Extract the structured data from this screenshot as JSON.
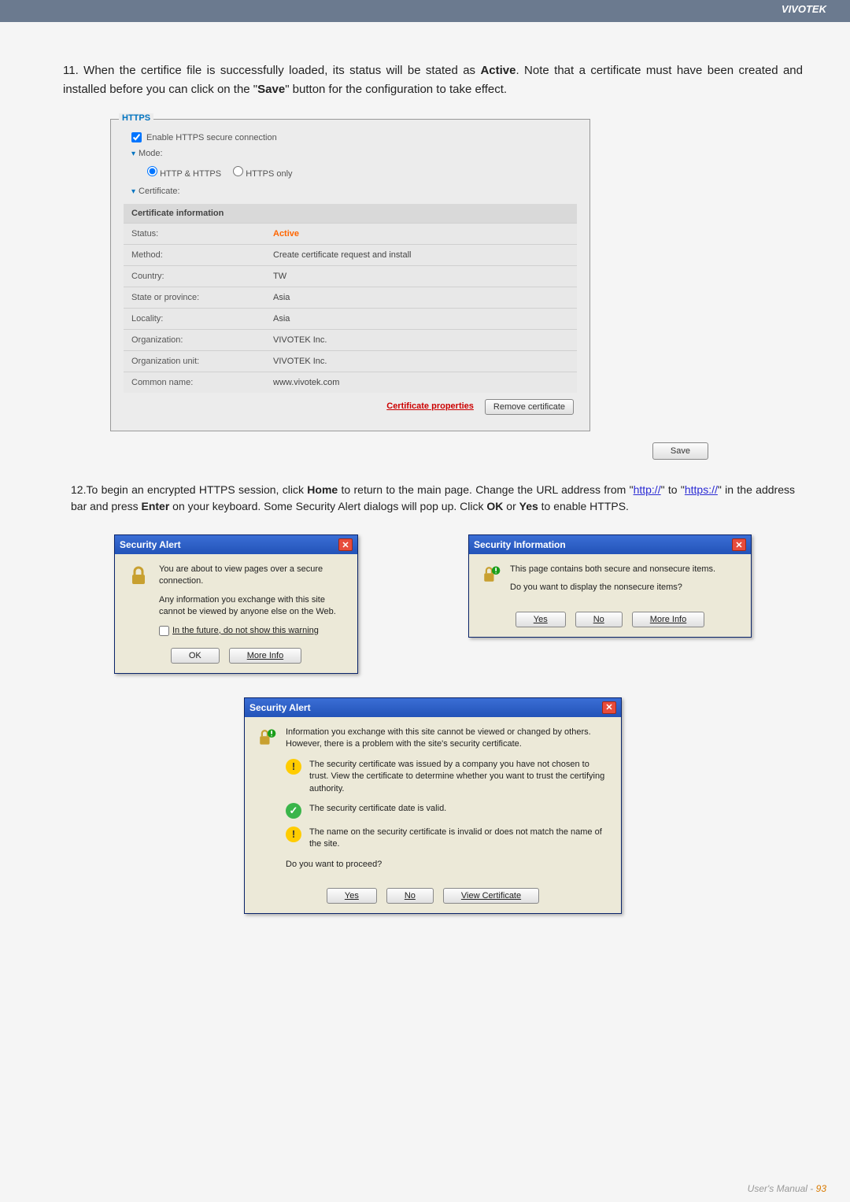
{
  "header": {
    "brand": "VIVOTEK"
  },
  "step11": {
    "num": "11.",
    "text_a": "When the certifice file is successfully loaded, its status will be stated as ",
    "active": "Active",
    "text_b": ". Note that a certificate must have been created and installed before you can click on the \"",
    "save": "Save",
    "text_c": "\" button for the configuration to take effect."
  },
  "panel": {
    "title": "HTTPS",
    "enable": "Enable HTTPS secure connection",
    "collapse": "▾",
    "mode": "Mode:",
    "opt1": "HTTP & HTTPS",
    "opt2": "HTTPS only",
    "cert_label": "Certificate:",
    "cert_info": "Certificate information",
    "rows": {
      "status_l": "Status:",
      "status_v": "Active",
      "method_l": "Method:",
      "method_v": "Create certificate request and install",
      "country_l": "Country:",
      "country_v": "TW",
      "state_l": "State or province:",
      "state_v": "Asia",
      "locality_l": "Locality:",
      "locality_v": "Asia",
      "org_l": "Organization:",
      "org_v": "VIVOTEK Inc.",
      "orgunit_l": "Organization unit:",
      "orgunit_v": "VIVOTEK Inc.",
      "cn_l": "Common name:",
      "cn_v": "www.vivotek.com"
    },
    "cert_props": "Certificate properties",
    "remove": "Remove certificate",
    "save_btn": "Save"
  },
  "step12": {
    "num": "12.",
    "text_a": "To begin an encrypted HTTPS session, click ",
    "home": "Home",
    "text_b": " to return to the main page. Change the URL address from \"",
    "http": "http://",
    "text_c": "\" to \"",
    "https": "https://",
    "text_d": "\" in the address bar and press ",
    "enter": "Enter",
    "text_e": " on your keyboard. Some Security Alert dialogs will pop up. Click ",
    "ok": "OK",
    "or": " or ",
    "yes": "Yes",
    "text_f": " to enable HTTPS."
  },
  "dlg1": {
    "title": "Security Alert",
    "line1": "You are about to view pages over a secure connection.",
    "line2": "Any information you exchange with this site cannot be viewed by anyone else on the Web.",
    "chk": "In the future, do not show this warning",
    "ok": "OK",
    "more": "More Info"
  },
  "dlg2": {
    "title": "Security Information",
    "line1": "This page contains both secure and nonsecure items.",
    "line2": "Do you want to display the nonsecure items?",
    "yes": "Yes",
    "no": "No",
    "more": "More Info"
  },
  "dlg3": {
    "title": "Security Alert",
    "intro": "Information you exchange with this site cannot be viewed or changed by others. However, there is a problem with the site's security certificate.",
    "w1": "The security certificate was issued by a company you have not chosen to trust. View the certificate to determine whether you want to trust the certifying authority.",
    "w2": "The security certificate date is valid.",
    "w3": "The name on the security certificate is invalid or does not match the name of the site.",
    "proceed": "Do you want to proceed?",
    "yes": "Yes",
    "no": "No",
    "view": "View Certificate"
  },
  "footer": {
    "text": "User's Manual - ",
    "num": "93"
  }
}
